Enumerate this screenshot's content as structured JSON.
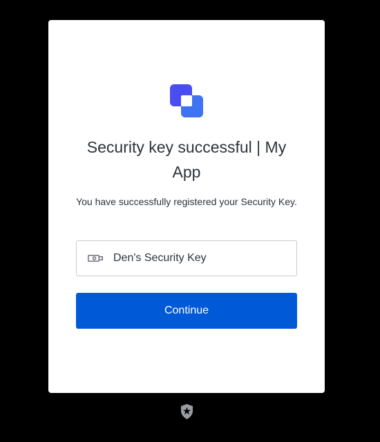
{
  "card": {
    "title": "Security key successful | My App",
    "description": "You have successfully registered your Security Key.",
    "key": {
      "icon": "usb-key-icon",
      "name": "Den's Security Key"
    },
    "continue_label": "Continue"
  },
  "branding": {
    "app_logo": "app-logo-icon",
    "footer_logo": "auth0-shield-icon"
  },
  "colors": {
    "background": "#000000",
    "card": "#ffffff",
    "primary": "#0059d6",
    "logo_light": "#5b80f8",
    "logo_dark": "#4a4ef0",
    "text": "#2d333a"
  }
}
